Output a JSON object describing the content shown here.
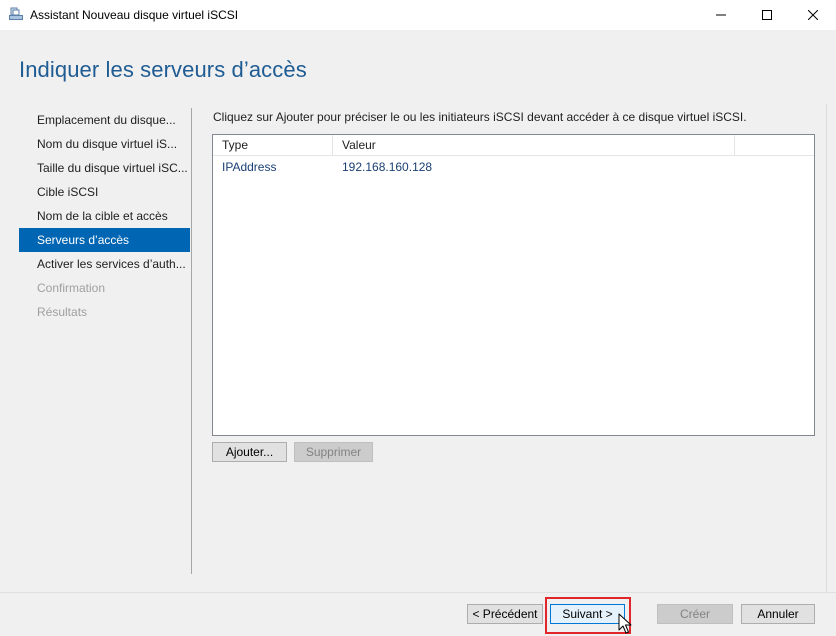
{
  "window": {
    "title": "Assistant Nouveau disque virtuel iSCSI",
    "controls": [
      "minimize",
      "maximize",
      "close"
    ],
    "accent_color": "#0066b3",
    "title_color": "#1f5c93"
  },
  "header": {
    "page_title": "Indiquer les serveurs d’accès"
  },
  "nav": {
    "items": [
      {
        "label": "Emplacement du disque...",
        "state": "normal"
      },
      {
        "label": "Nom du disque virtuel iS...",
        "state": "normal"
      },
      {
        "label": "Taille du disque virtuel iSC...",
        "state": "normal"
      },
      {
        "label": "Cible iSCSI",
        "state": "normal"
      },
      {
        "label": "Nom de la cible et accès",
        "state": "normal"
      },
      {
        "label": "Serveurs d’accès",
        "state": "active"
      },
      {
        "label": "Activer les services d’auth...",
        "state": "normal"
      },
      {
        "label": "Confirmation",
        "state": "disabled"
      },
      {
        "label": "Résultats",
        "state": "disabled"
      }
    ]
  },
  "main": {
    "instruction": "Cliquez sur Ajouter pour préciser le ou les initiateurs iSCSI devant accéder à ce disque virtuel iSCSI.",
    "table": {
      "columns": [
        "Type",
        "Valeur",
        ""
      ],
      "rows": [
        {
          "type": "IPAddress",
          "value": "192.168.160.128"
        }
      ]
    },
    "add_label": "Ajouter...",
    "remove_label": "Supprimer"
  },
  "footer": {
    "previous_label": "< Précédent",
    "next_label": "Suivant >",
    "create_label": "Créer",
    "cancel_label": "Annuler"
  }
}
